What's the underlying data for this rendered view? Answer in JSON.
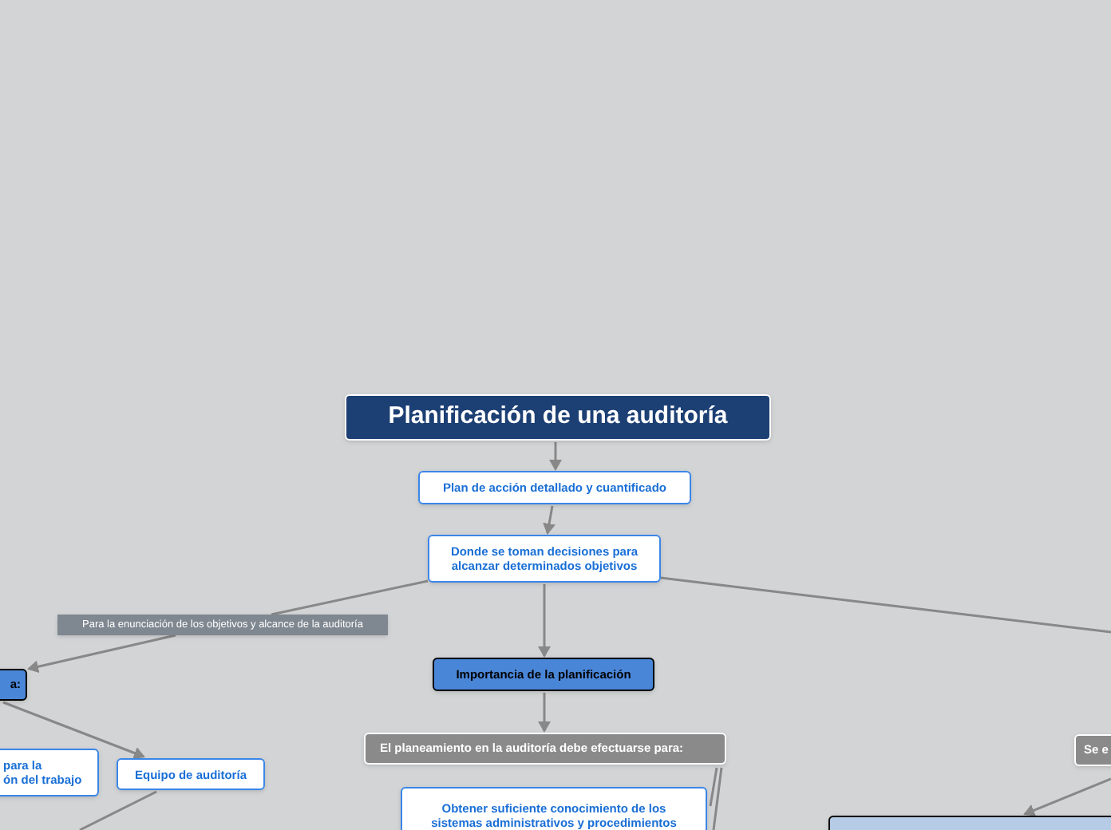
{
  "nodes": [
    {
      "kind": "title",
      "text": "Planificación de una auditoría"
    },
    {
      "kind": "white",
      "text": "Plan de acción detallado y cuantificado"
    },
    {
      "kind": "white",
      "text": "Donde se toman decisiones para\nalcanzar determinados objetivos"
    },
    {
      "kind": "label",
      "text": "Para la enunciación de los objetivos y alcance de la auditoría"
    },
    {
      "kind": "blue",
      "text": "a:"
    },
    {
      "kind": "white",
      "text": "para la\nón del trabajo"
    },
    {
      "kind": "white",
      "text": "Equipo de auditoría"
    },
    {
      "kind": "blue",
      "text": "Importancia de la planificación"
    },
    {
      "kind": "gray",
      "text": "El planeamiento en la auditoría debe efectuarse para:"
    },
    {
      "kind": "white",
      "text": "Obtener suficiente conocimiento de los\nsistemas administrativos y procedimientos"
    },
    {
      "kind": "gray",
      "text": "Se e"
    },
    {
      "kind": "lightblue"
    }
  ]
}
